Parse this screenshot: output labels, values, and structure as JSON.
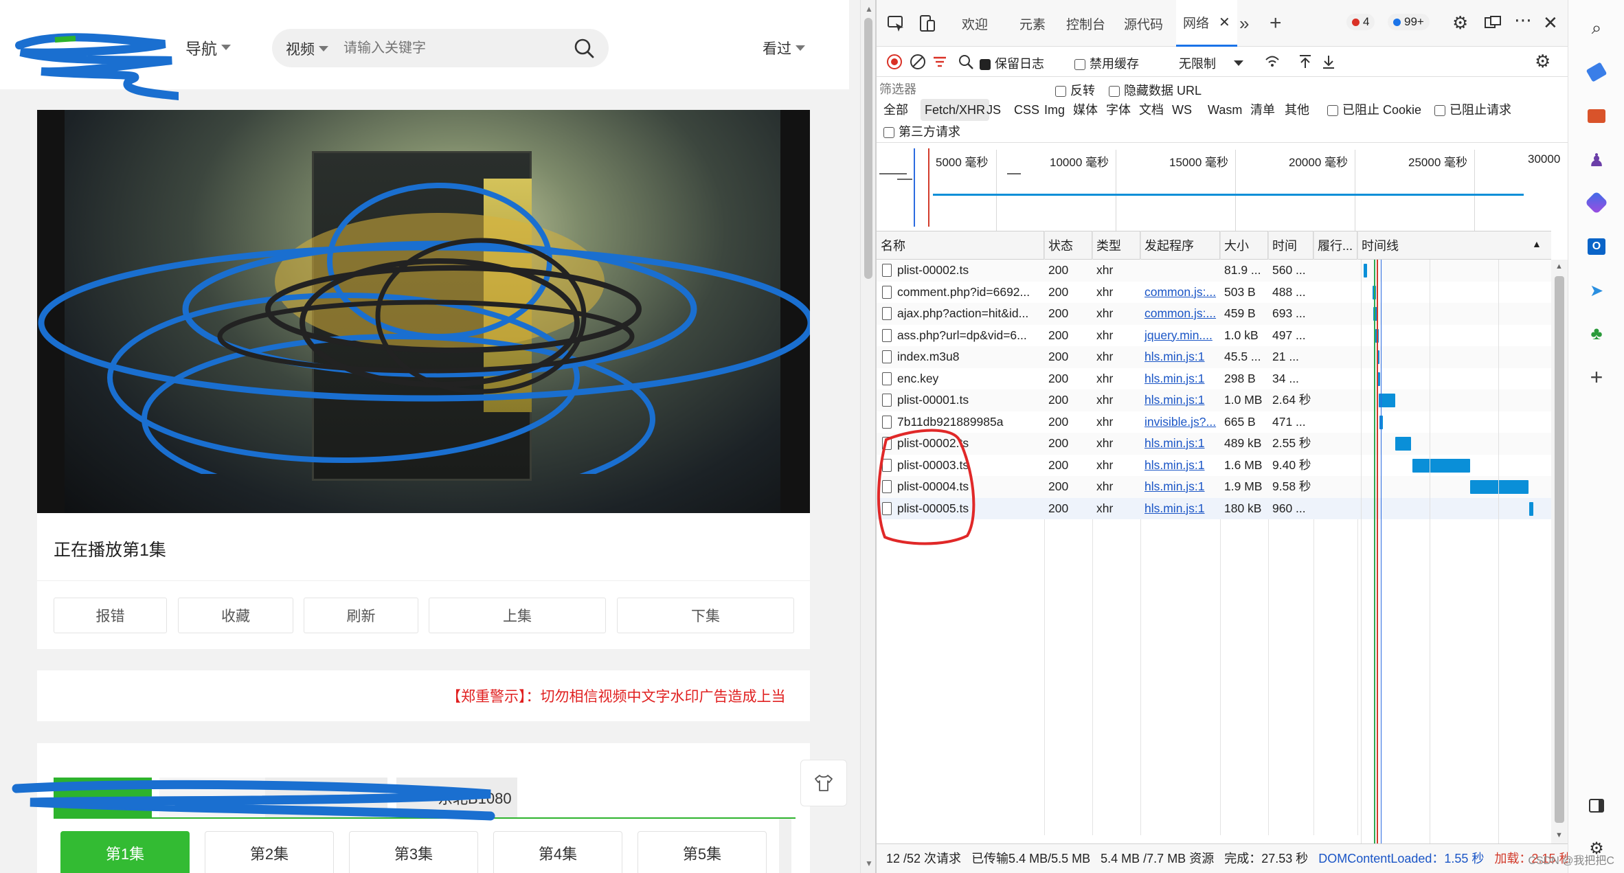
{
  "site": {
    "nav_label": "导航",
    "search_type": "视频",
    "search_placeholder": "请输入关键字",
    "history_label": "看过",
    "now_playing": "正在播放第1集",
    "actions": [
      "报错",
      "收藏",
      "刷新",
      "上集",
      "下集"
    ],
    "warning": "【郑重警示】：切勿相信视频中文字水印广告造成上当",
    "source_tabs": [
      "",
      "",
      "",
      "东北B1080"
    ],
    "episodes": [
      "第1集",
      "第2集",
      "第3集",
      "第4集",
      "第5集"
    ],
    "active_episode_color": "#33bb33"
  },
  "devtools": {
    "tabs": [
      "欢迎",
      "元素",
      "控制台",
      "源代码",
      "网络"
    ],
    "active_tab": "网络",
    "error_count": "4",
    "message_count": "99+",
    "toolbar": {
      "preserve_log": "保留日志",
      "disable_cache": "禁用缓存",
      "throttle": "无限制"
    },
    "filter": {
      "placeholder": "筛选器",
      "invert": "反转",
      "hide_data_urls": "隐藏数据 URL"
    },
    "types": [
      "全部",
      "Fetch/XHR",
      "JS",
      "CSS",
      "Img",
      "媒体",
      "字体",
      "文档",
      "WS",
      "Wasm",
      "清单",
      "其他"
    ],
    "active_type": "Fetch/XHR",
    "blocked_cookies": "已阻止 Cookie",
    "blocked_requests": "已阻止请求",
    "third_party": "第三方请求",
    "overview_ticks": [
      "5000 毫秒",
      "10000 毫秒",
      "15000 毫秒",
      "20000 毫秒",
      "25000 毫秒",
      "30000"
    ],
    "columns": [
      "名称",
      "状态",
      "类型",
      "发起程序",
      "大小",
      "时间",
      "履行...",
      "时间线"
    ],
    "requests": [
      {
        "name": "plist-00002.ts",
        "status": "200",
        "type": "xhr",
        "initiator": "",
        "size": "81.9 ...",
        "time": "560 ...",
        "bar_start": 0.01,
        "bar_width": 0.02
      },
      {
        "name": "comment.php?id=6692...",
        "status": "200",
        "type": "xhr",
        "initiator": "common.js:...",
        "size": "503 B",
        "time": "488 ...",
        "bar_start": 0.06,
        "bar_width": 0.018
      },
      {
        "name": "ajax.php?action=hit&id...",
        "status": "200",
        "type": "xhr",
        "initiator": "common.js:...",
        "size": "459 B",
        "time": "693 ...",
        "bar_start": 0.062,
        "bar_width": 0.022
      },
      {
        "name": "ass.php?url=dp&vid=6...",
        "status": "200",
        "type": "xhr",
        "initiator": "jquery.min....",
        "size": "1.0 kB",
        "time": "497 ...",
        "bar_start": 0.075,
        "bar_width": 0.018
      },
      {
        "name": "index.m3u8",
        "status": "200",
        "type": "xhr",
        "initiator": "hls.min.js:1",
        "size": "45.5 ...",
        "time": "21 ...",
        "bar_start": 0.082,
        "bar_width": 0.006
      },
      {
        "name": "enc.key",
        "status": "200",
        "type": "xhr",
        "initiator": "hls.min.js:1",
        "size": "298 B",
        "time": "34 ...",
        "bar_start": 0.086,
        "bar_width": 0.006
      },
      {
        "name": "plist-00001.ts",
        "status": "200",
        "type": "xhr",
        "initiator": "hls.min.js:1",
        "size": "1.0 MB",
        "time": "2.64 秒",
        "bar_start": 0.092,
        "bar_width": 0.088
      },
      {
        "name": "7b11db921889985a",
        "status": "200",
        "type": "xhr",
        "initiator": "invisible.js?...",
        "size": "665 B",
        "time": "471 ...",
        "bar_start": 0.098,
        "bar_width": 0.016
      },
      {
        "name": "plist-00002.ts",
        "status": "200",
        "type": "xhr",
        "initiator": "hls.min.js:1",
        "size": "489 kB",
        "time": "2.55 秒",
        "bar_start": 0.18,
        "bar_width": 0.085
      },
      {
        "name": "plist-00003.ts",
        "status": "200",
        "type": "xhr",
        "initiator": "hls.min.js:1",
        "size": "1.6 MB",
        "time": "9.40 秒",
        "bar_start": 0.275,
        "bar_width": 0.31
      },
      {
        "name": "plist-00004.ts",
        "status": "200",
        "type": "xhr",
        "initiator": "hls.min.js:1",
        "size": "1.9 MB",
        "time": "9.58 秒",
        "bar_start": 0.585,
        "bar_width": 0.315
      },
      {
        "name": "plist-00005.ts",
        "status": "200",
        "type": "xhr",
        "initiator": "hls.min.js:1",
        "size": "180 kB",
        "time": "960 ...",
        "bar_start": 0.902,
        "bar_width": 0.025
      }
    ],
    "status_bar": {
      "requests": "12 /52 次请求",
      "transferred": "已传输5.4 MB/5.5 MB",
      "resources": "5.4 MB /7.7 MB 资源",
      "finish": "完成：27.53 秒",
      "dom_loaded": "DOMContentLoaded：1.55 秒",
      "load": "加载：2.15 秒"
    },
    "colors": {
      "link": "#1a55c6",
      "bar": "#0a8fd8",
      "dom_line": "#2b6be0",
      "load_line": "#d23b2b",
      "error": "#d93025"
    }
  },
  "watermark": "CSDN @我把把C"
}
